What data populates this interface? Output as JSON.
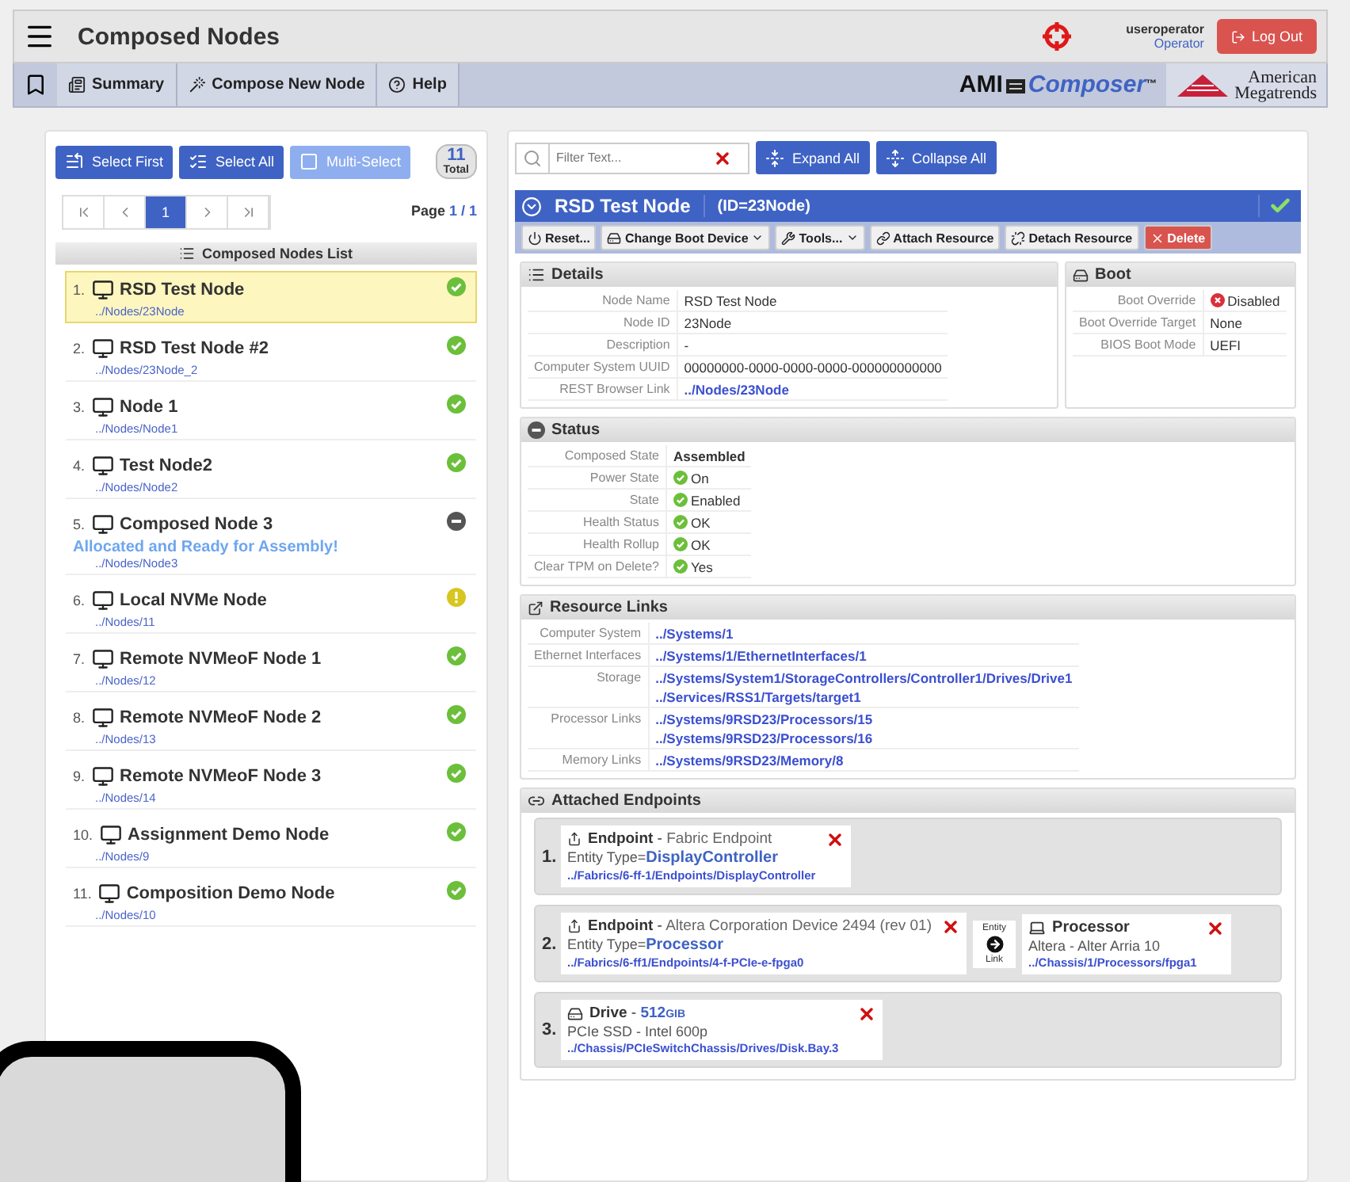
{
  "header": {
    "title": "Composed Nodes",
    "user": "useroperator",
    "role": "Operator",
    "logout": "Log Out"
  },
  "nav": {
    "tabs": [
      {
        "label": "Summary",
        "kind": "summary"
      },
      {
        "label": "Compose New Node",
        "kind": "compose"
      },
      {
        "label": "Help",
        "kind": "help"
      }
    ],
    "brand": {
      "ami": "AMI",
      "product": "Composer",
      "tm": "™",
      "company_line_1": "American",
      "company_line_2": "Megatrends"
    }
  },
  "left": {
    "buttons": [
      {
        "label": "Select First",
        "kind": "first",
        "disabled": false
      },
      {
        "label": "Select All",
        "kind": "all",
        "disabled": false
      },
      {
        "label": "Multi-Select",
        "kind": "multi",
        "disabled": true
      }
    ],
    "count": {
      "value": "11",
      "label": "Total"
    },
    "pager": {
      "buttons": [
        {
          "kind": "first",
          "selected": false
        },
        {
          "kind": "prev",
          "selected": false
        },
        {
          "kind": "page",
          "label": "1",
          "selected": true
        },
        {
          "kind": "next",
          "selected": false
        },
        {
          "kind": "last",
          "selected": false
        }
      ],
      "label": "Page",
      "value": "1 / 1"
    },
    "list_title": "Composed Nodes List",
    "nodes": [
      {
        "number": "1.",
        "name": "RSD Test Node",
        "link": "../Nodes/23Node",
        "kind": "ok",
        "selected": true
      },
      {
        "number": "2.",
        "name": "RSD Test Node #2",
        "link": "../Nodes/23Node_2",
        "kind": "ok",
        "selected": false
      },
      {
        "number": "3.",
        "name": "Node 1",
        "link": "../Nodes/Node1",
        "kind": "ok",
        "selected": false
      },
      {
        "number": "4.",
        "name": "Test Node2",
        "link": "../Nodes/Node2",
        "kind": "ok",
        "selected": false
      },
      {
        "number": "5.",
        "name": "Composed Node 3",
        "note": "Allocated and Ready for Assembly!",
        "link": "../Nodes/Node3",
        "kind": "off",
        "selected": false
      },
      {
        "number": "6.",
        "name": "Local NVMe Node",
        "link": "../Nodes/11",
        "kind": "warning",
        "selected": false
      },
      {
        "number": "7.",
        "name": "Remote NVMeoF Node 1",
        "link": "../Nodes/12",
        "kind": "ok",
        "selected": false
      },
      {
        "number": "8.",
        "name": "Remote NVMeoF Node 2",
        "link": "../Nodes/13",
        "kind": "ok",
        "selected": false
      },
      {
        "number": "9.",
        "name": "Remote NVMeoF Node 3",
        "link": "../Nodes/14",
        "kind": "ok",
        "selected": false
      },
      {
        "number": "10.",
        "name": "Assignment Demo Node",
        "link": "../Nodes/9",
        "kind": "ok",
        "selected": false
      },
      {
        "number": "11.",
        "name": "Composition Demo Node",
        "link": "../Nodes/10",
        "kind": "ok",
        "selected": false
      }
    ]
  },
  "right": {
    "filter": {
      "placeholder": "Filter Text..."
    },
    "buttons": [
      {
        "label": "Expand All",
        "kind": "expand"
      },
      {
        "label": "Collapse All",
        "kind": "collapse"
      }
    ],
    "node": {
      "name": "RSD Test Node",
      "id": "(ID=23Node)"
    },
    "actions": [
      {
        "label": "Reset...",
        "kind": "reset",
        "dropdown": false
      },
      {
        "label": "Change Boot Device",
        "kind": "boot",
        "dropdown": true
      },
      {
        "label": "Tools...",
        "kind": "tools",
        "dropdown": true
      },
      {
        "label": "Attach Resource",
        "kind": "attach",
        "dropdown": false
      },
      {
        "label": "Detach Resource",
        "kind": "detach",
        "dropdown": false
      },
      {
        "label": "Delete",
        "kind": "delete",
        "dropdown": false
      }
    ],
    "details": {
      "title": "Details",
      "rows": [
        {
          "label": "Node Name",
          "value": "RSD Test Node",
          "kind": "text"
        },
        {
          "label": "Node ID",
          "value": "23Node",
          "kind": "text"
        },
        {
          "label": "Description",
          "value": "-",
          "kind": "text"
        },
        {
          "label": "Computer System UUID",
          "value": "00000000-0000-0000-0000-000000000000",
          "kind": "text"
        },
        {
          "label": "REST Browser Link",
          "value": "../Nodes/23Node",
          "kind": "link"
        }
      ]
    },
    "boot": {
      "title": "Boot",
      "rows": [
        {
          "label": "Boot Override",
          "value": "Disabled",
          "kind": "error"
        },
        {
          "label": "Boot Override Target",
          "value": "None",
          "kind": "text"
        },
        {
          "label": "BIOS Boot Mode",
          "value": "UEFI",
          "kind": "text"
        }
      ]
    },
    "status": {
      "title": "Status",
      "rows": [
        {
          "label": "Composed State",
          "value": "Assembled",
          "kind": "bold"
        },
        {
          "label": "Power State",
          "value": "On",
          "kind": "ok"
        },
        {
          "label": "State",
          "value": "Enabled",
          "kind": "ok"
        },
        {
          "label": "Health Status",
          "value": "OK",
          "kind": "ok"
        },
        {
          "label": "Health Rollup",
          "value": "OK",
          "kind": "ok"
        },
        {
          "label": "Clear TPM on Delete?",
          "value": "Yes",
          "kind": "ok"
        }
      ]
    },
    "resources": {
      "title": "Resource Links",
      "rows": [
        {
          "label": "Computer System",
          "links": [
            "../Systems/1"
          ]
        },
        {
          "label": "Ethernet Interfaces",
          "links": [
            "../Systems/1/EthernetInterfaces/1"
          ]
        },
        {
          "label": "Storage",
          "links": [
            "../Systems/System1/StorageControllers/Controller1/Drives/Drive1",
            "../Services/RSS1/Targets/target1"
          ]
        },
        {
          "label": "Processor Links",
          "links": [
            "../Systems/9RSD23/Processors/15",
            "../Systems/9RSD23/Processors/16"
          ]
        },
        {
          "label": "Memory Links",
          "links": [
            "../Systems/9RSD23/Memory/8"
          ]
        }
      ]
    },
    "endpoints": {
      "title": "Attached Endpoints",
      "items": [
        {
          "number": "1.",
          "cards": [
            {
              "kind": "endpoint",
              "title": "Endpoint",
              "separator": "-",
              "subtitle": "Fabric Endpoint",
              "entity_label": "Entity Type=",
              "entity_value": "DisplayController",
              "link": "../Fabrics/6-ff-1/Endpoints/DisplayController"
            }
          ]
        },
        {
          "number": "2.",
          "cards": [
            {
              "kind": "endpoint",
              "title": "Endpoint",
              "separator": "-",
              "subtitle": "Altera Corporation Device 2494 (rev 01)",
              "entity_label": "Entity Type=",
              "entity_value": "Processor",
              "link": "../Fabrics/6-ff1/Endpoints/4-f-PCIe-e-fpga0"
            },
            {
              "kind": "connector",
              "top": "Entity",
              "bottom": "Link"
            },
            {
              "kind": "processor",
              "title": "Processor",
              "description": "Altera - Alter Arria 10",
              "link": "../Chassis/1/Processors/fpga1"
            }
          ]
        },
        {
          "number": "3.",
          "cards": [
            {
              "kind": "drive",
              "title": "Drive",
              "separator": "-",
              "size": "512",
              "unit": "GIB",
              "description": "PCIe SSD - Intel 600p",
              "link": "../Chassis/PCIeSwitchChassis/Drives/Disk.Bay.3"
            }
          ]
        }
      ]
    }
  }
}
